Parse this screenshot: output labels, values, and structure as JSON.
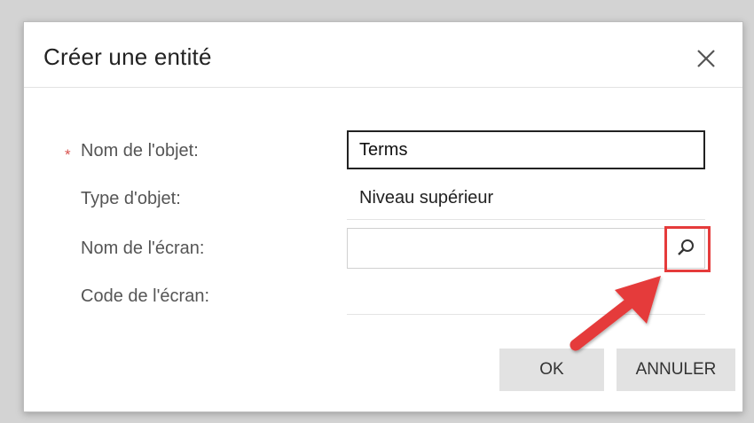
{
  "dialog": {
    "title": "Créer une entité",
    "close_icon": "close-icon"
  },
  "form": {
    "object_name": {
      "label": "Nom de l'objet:",
      "required_mark": "*",
      "value": "Terms"
    },
    "object_type": {
      "label": "Type d'objet:",
      "value": "Niveau supérieur"
    },
    "screen_name": {
      "label": "Nom de l'écran:",
      "value": "",
      "search_icon": "search-icon"
    },
    "screen_code": {
      "label": "Code de l'écran:",
      "value": ""
    }
  },
  "buttons": {
    "ok_label": "OK",
    "cancel_label": "ANNULER"
  },
  "colors": {
    "highlight": "#e53b3b",
    "required": "#d9534f",
    "button_bg": "#e2e2e2"
  }
}
